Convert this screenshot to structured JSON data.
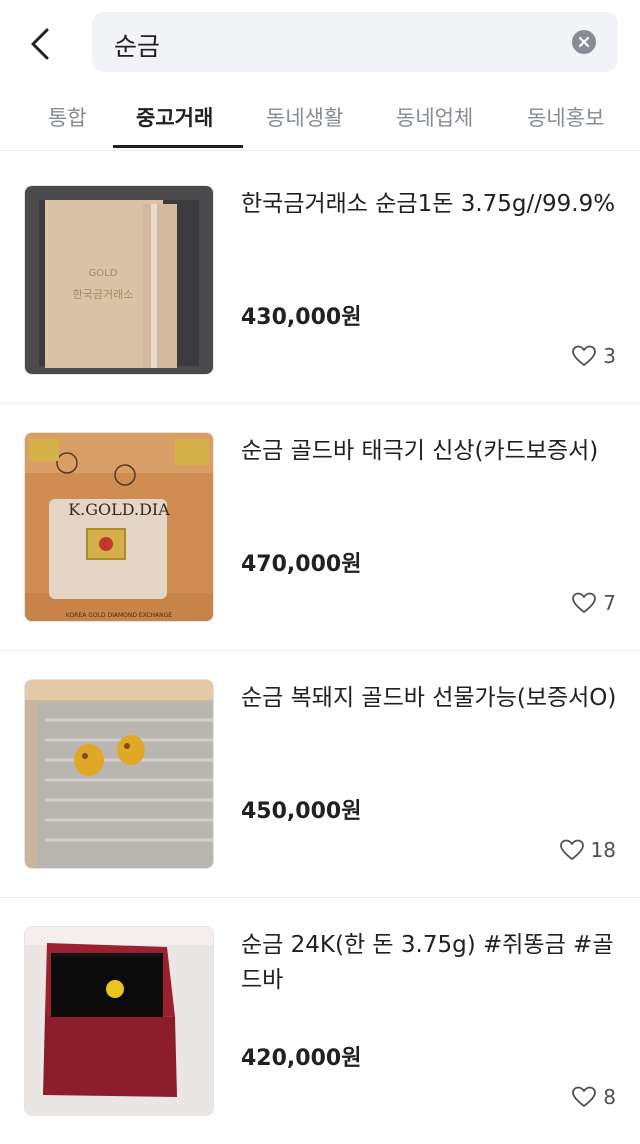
{
  "search": {
    "query": "순금"
  },
  "tabs": [
    {
      "label": "통합",
      "active": false
    },
    {
      "label": "중고거래",
      "active": true
    },
    {
      "label": "동네생활",
      "active": false
    },
    {
      "label": "동네업체",
      "active": false
    },
    {
      "label": "동네홍보",
      "active": false
    }
  ],
  "items": [
    {
      "title": "한국금거래소 순금1돈 3.75g//99.9%",
      "price": "430,000원",
      "likes": "3",
      "image": "gold-box-photo"
    },
    {
      "title": "순금 골드바 태극기 신상(카드보증서)",
      "price": "470,000원",
      "likes": "7",
      "image": "gold-bar-card-photo"
    },
    {
      "title": "순금 복돼지 골드바 선물가능(보증서O)",
      "price": "450,000원",
      "likes": "18",
      "image": "gold-pig-photo"
    },
    {
      "title": "순금 24K(한 돈 3.75g) #쥐똥금 #골드바",
      "price": "420,000원",
      "likes": "8",
      "image": "gold-nugget-box-photo"
    }
  ],
  "colors": {
    "text": "#212124",
    "muted": "#868b94",
    "search_bg": "#f2f3f6"
  }
}
